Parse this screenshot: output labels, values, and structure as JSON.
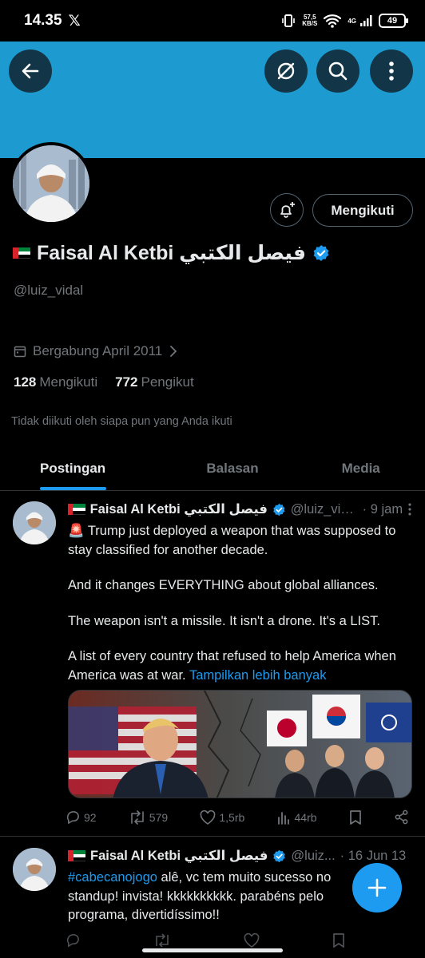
{
  "status": {
    "time": "14.35",
    "x_glyph": "𝕏",
    "speed": "57,5",
    "speed_unit": "KB/S",
    "net": "4G",
    "battery": "49"
  },
  "profile": {
    "display_name": "Faisal Al Ketbi فيصل الكتبي",
    "handle": "@luiz_vidal",
    "joined": "Bergabung April 2011",
    "following_count": "128",
    "following_label": "Mengikuti",
    "followers_count": "772",
    "followers_label": "Pengikut",
    "not_followed": "Tidak diikuti oleh siapa pun yang Anda ikuti",
    "follow_button": "Mengikuti"
  },
  "tabs": [
    {
      "label": "Postingan",
      "active": true
    },
    {
      "label": "Balasan",
      "active": false
    },
    {
      "label": "Media",
      "active": false
    }
  ],
  "posts": [
    {
      "name": "Faisal Al Ketbi فيصل الكتبي",
      "handle": "@luiz_vid...",
      "time": "· 9 jam",
      "para1": "🚨 Trump just deployed a weapon that was supposed to stay classified for another decade.",
      "para2": "And it changes EVERYTHING about global alliances.",
      "para3": "The weapon isn't a missile. It isn't a drone. It's a LIST.",
      "para4": "A list of every country that refused to help America when America was at war.",
      "show_more": "Tampilkan lebih banyak",
      "replies": "92",
      "reposts": "579",
      "likes": "1,5rb",
      "views": "44rb"
    },
    {
      "name": "Faisal Al Ketbi فيصل الكتبي",
      "handle": "@luiz...",
      "time": "· 16 Jun 13",
      "hashtag": "#cabecanojogo",
      "text": " alê, vc tem muito sucesso no standup! invista! kkkkkkkkkk.  parabéns pelo programa, divertidíssimo!!"
    }
  ],
  "colors": {
    "banner": "#1d9bd0",
    "accent": "#1d9bf0",
    "background": "#000000"
  },
  "icons": [
    "back-arrow-icon",
    "grok-icon",
    "search-icon",
    "more-vertical-icon",
    "bell-plus-icon",
    "verified-badge-icon",
    "calendar-icon",
    "chevron-right-icon",
    "reply-icon",
    "repost-icon",
    "like-icon",
    "views-icon",
    "bookmark-icon",
    "share-icon",
    "plus-icon"
  ]
}
